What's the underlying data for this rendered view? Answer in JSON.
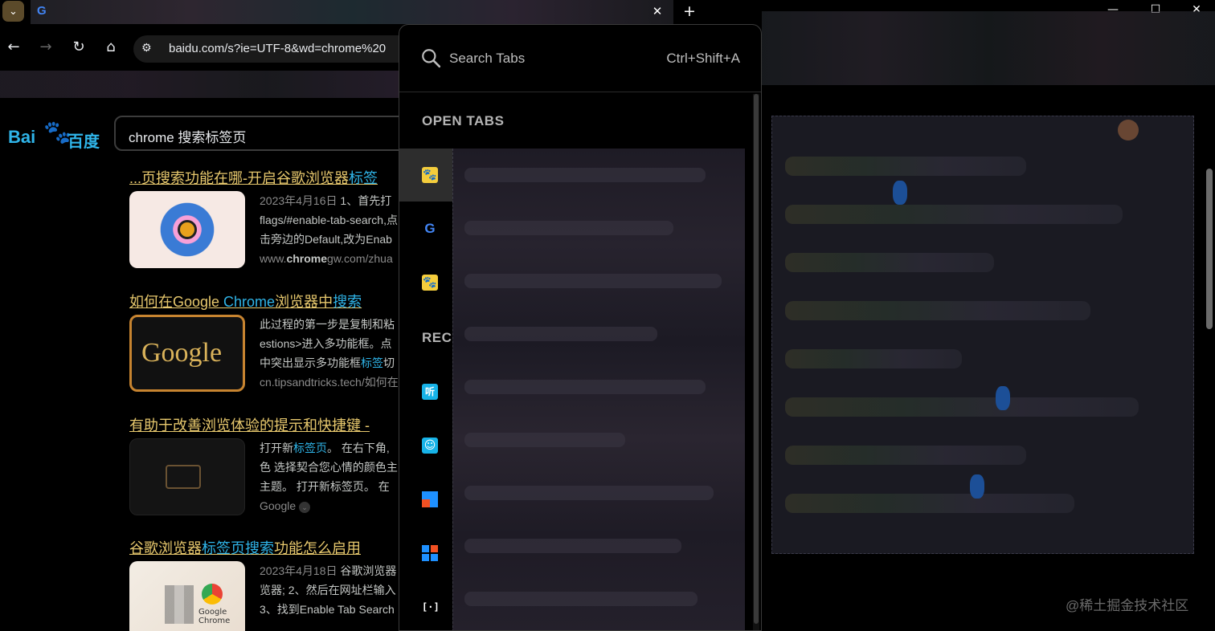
{
  "titlebar": {
    "tab_menu_icon": "chevron-down-icon",
    "active_tab_icon": "google-icon",
    "active_tab_glyph": "G",
    "close_glyph": "✕",
    "new_tab_glyph": "+",
    "minimize_glyph": "—",
    "maximize_glyph": "☐",
    "window_close_glyph": "✕"
  },
  "toolbar": {
    "back_glyph": "←",
    "forward_glyph": "→",
    "reload_glyph": "↻",
    "home_glyph": "⌂",
    "site_info_glyph": "⚙",
    "url": "baidu.com/s?ie=UTF-8&wd=chrome%20"
  },
  "page": {
    "logo_bai": "Bai",
    "logo_paw": "🐾",
    "logo_du": "百度",
    "query": "chrome 搜索标签页",
    "results": [
      {
        "title_pre": "...页搜索功能在哪-开启谷歌浏览器",
        "title_hl": "标签",
        "title_post": "",
        "lines": [
          {
            "date": "2023年4月16日",
            "text": " 1、首先打"
          },
          {
            "text": "flags/#enable-tab-search,点"
          },
          {
            "text": "击旁边的Default,改为Enab"
          }
        ],
        "src_pre": "www.",
        "src_bold": "chrome",
        "src_post": "gw.com/zhua"
      },
      {
        "title_pre": "如何在Google ",
        "title_hl": "Chrome",
        "title_mid": "浏览器中",
        "title_hl2": "搜索",
        "title_post": "",
        "lines": [
          {
            "text": "此过程的第一步是复制和粘"
          },
          {
            "text": "estions>进入多功能框。点"
          },
          {
            "text_pre": "中突出显示多功能框",
            "hl": "标签",
            "text_post": "切"
          }
        ],
        "src": "cn.tipsandtricks.tech/如何在"
      },
      {
        "title_pre": "有助于改善浏览体验的提示和快捷键 -",
        "lines": [
          {
            "text_pre": "打开新",
            "hl": "标签页",
            "text_post": "。 在右下角,"
          },
          {
            "text": "色 选择契合您心情的颜色主"
          },
          {
            "text": "主题。 打开新标签页。 在"
          }
        ],
        "src": "Google"
      },
      {
        "title_pre": "谷歌浏览器",
        "title_hl": "标签页搜索",
        "title_post": "功能怎么启用 ",
        "lines": [
          {
            "date": "2023年4月18日",
            "text": " 谷歌浏览器"
          },
          {
            "text": "览器; 2、然后在网址栏输入"
          },
          {
            "text": "3、找到Enable Tab Search"
          }
        ],
        "thumb_label_1": "Google",
        "thumb_label_2": "Chrome"
      }
    ]
  },
  "popup": {
    "search_placeholder": "Search Tabs",
    "shortcut": "Ctrl+Shift+A",
    "open_tabs_header": "OPEN TABS",
    "recent_header": "RECE",
    "open_tabs": [
      {
        "icon": "baidu-paw-icon",
        "glyph": "🐾",
        "bg": "#f4cd3c",
        "selected": true
      },
      {
        "icon": "google-icon",
        "glyph": "G",
        "bg": "transparent",
        "selected": false
      },
      {
        "icon": "baidu-paw-icon",
        "glyph": "🐾",
        "bg": "#f4cd3c",
        "selected": false
      }
    ],
    "recent_tabs": [
      {
        "icon": "listen-icon",
        "glyph": "听",
        "bg": "#17b3e8"
      },
      {
        "icon": "face-icon",
        "glyph": "☺",
        "bg": "#17b3e8"
      },
      {
        "icon": "windows-icon",
        "glyph": "",
        "bg": "windows"
      },
      {
        "icon": "windows-icon",
        "glyph": "",
        "bg": "windows"
      },
      {
        "icon": "bracket-icon",
        "glyph": "[·]",
        "bg": "transparent"
      }
    ]
  },
  "watermark": "@稀土掘金技术社区"
}
